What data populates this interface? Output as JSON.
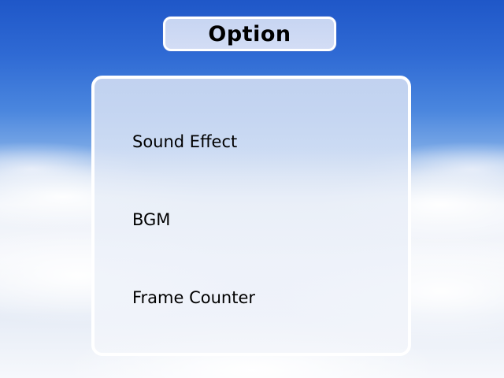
{
  "screen": {
    "title": "Option"
  },
  "options": [
    {
      "label": "Sound Effect"
    },
    {
      "label": "BGM"
    },
    {
      "label": "Frame Counter"
    }
  ],
  "colors": {
    "sky_top": "#1f57c8",
    "cloud": "#f4f6fb",
    "title_box": "#c7d5f2",
    "panel": "#d7e2f5",
    "border": "#ffffff",
    "text": "#000000"
  }
}
